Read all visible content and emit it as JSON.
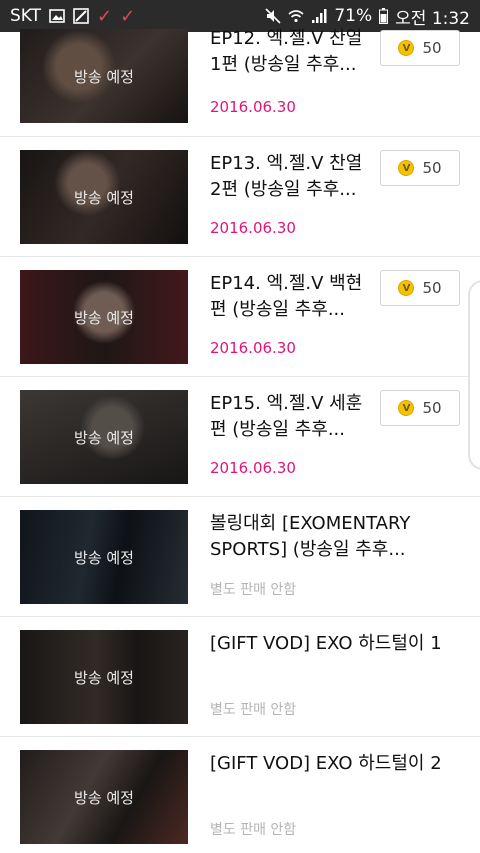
{
  "statusbar": {
    "carrier": "SKT",
    "battery": "71%",
    "time": "오전 1:32",
    "icons": [
      "image-icon",
      "screenshot-icon",
      "check-icon",
      "check-icon",
      "mute-icon",
      "wifi-icon",
      "signal-icon",
      "battery-icon"
    ]
  },
  "thumb_label": "방송 예정",
  "rows": [
    {
      "title": "EP12. 엑.젤.V 찬열 1편 (방송일 추후...",
      "date": "2016.06.30",
      "price": "50"
    },
    {
      "title": "EP13. 엑.젤.V 찬열 2편 (방송일 추후...",
      "date": "2016.06.30",
      "price": "50"
    },
    {
      "title": "EP14. 엑.젤.V 백현 편 (방송일 추후...",
      "date": "2016.06.30",
      "price": "50"
    },
    {
      "title": "EP15. 엑.젤.V 세훈 편 (방송일 추후...",
      "date": "2016.06.30",
      "price": "50"
    },
    {
      "title": "볼링대회 [EXOMENTARY SPORTS] (방송일 추후...",
      "note": "별도 판매 안함"
    },
    {
      "title": "[GIFT VOD] EXO 하드털이 1",
      "note": "별도 판매 안함"
    },
    {
      "title": "[GIFT VOD] EXO 하드털이 2",
      "note": "별도 판매 안함"
    }
  ],
  "colors": {
    "date": "#e0157a",
    "coin": "#f2c200"
  }
}
